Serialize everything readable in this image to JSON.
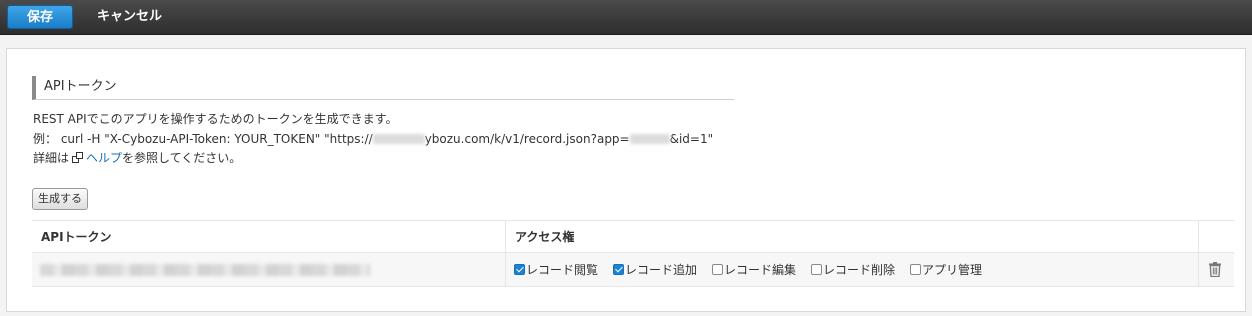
{
  "toolbar": {
    "save_label": "保存",
    "cancel_label": "キャンセル"
  },
  "section": {
    "title": "APIトークン"
  },
  "description": {
    "line1": "REST APIでこのアプリを操作するためのトークンを生成できます。",
    "line2_prefix": "例： curl -H \"X-Cybozu-API-Token: YOUR_TOKEN\" \"https://",
    "line2_mid": "ybozu.com/k/v1/record.json?app=",
    "line2_suffix": "&id=1\"",
    "line3_prefix": "詳細は",
    "help_link": "ヘルプ",
    "line3_suffix": "を参照してください。"
  },
  "generate_button": "生成する",
  "table": {
    "headers": {
      "token": "APIトークン",
      "access": "アクセス権"
    },
    "rows": [
      {
        "permissions": [
          {
            "label": "レコード閲覧",
            "checked": true
          },
          {
            "label": "レコード追加",
            "checked": true
          },
          {
            "label": "レコード編集",
            "checked": false
          },
          {
            "label": "レコード削除",
            "checked": false
          },
          {
            "label": "アプリ管理",
            "checked": false
          }
        ]
      }
    ]
  },
  "icons": {
    "external": "external-link-icon",
    "delete": "trash-icon"
  },
  "colors": {
    "accent": "#1a7dc8",
    "link": "#1a6fb5",
    "checkbox_checked": "#1b82d4"
  }
}
